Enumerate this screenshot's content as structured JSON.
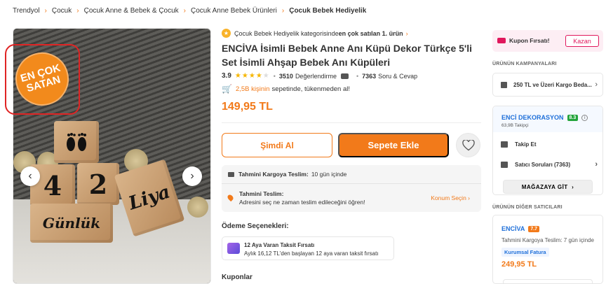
{
  "breadcrumb": [
    "Trendyol",
    "Çocuk",
    "Çocuk Anne & Bebek & Çocuk",
    "Çocuk Anne Bebek Ürünleri",
    "Çocuk Bebek Hediyelik"
  ],
  "gallery": {
    "badge_line1": "EN ÇOK",
    "badge_line2": "SATAN",
    "block_digits": [
      "4",
      "2"
    ],
    "block_text_1": "Liya",
    "block_text_2": "Günlük"
  },
  "product": {
    "bestseller_prefix": "Çocuk Bebek Hediyelik kategorisinde ",
    "bestseller_bold": "en çok satılan 1. ürün",
    "brand": "ENCİVA",
    "title": " İsimli Bebek Anne Anı Küpü Dekor Türkçe 5'li Set İsimli Ahşap Bebek Anı Küpüleri",
    "rating": "3.9",
    "rating_stars": 3.9,
    "review_count": "3510",
    "review_label": "Değerlendirme",
    "qa_count": "7363",
    "qa_label": "Soru & Cevap",
    "cart_count_text": "2,5B kişinin",
    "cart_suffix": "sepetinde, tükenmeden al!",
    "price": "149,95 TL",
    "buy_now_label": "Şimdi Al",
    "add_to_cart_label": "Sepete Ekle"
  },
  "delivery": {
    "cargo_label": "Tahmini Kargoya Teslim:",
    "cargo_value": "10 gün içinde",
    "title": "Tahmini Teslim:",
    "subtitle": "Adresini seç ne zaman teslim edileceğini öğren!",
    "location_link": "Konum Seçin"
  },
  "payment": {
    "title": "Ödeme Seçenekleri:",
    "installment_title": "12 Aya Varan Taksit Fırsatı",
    "installment_sub": "Aylık 16,12 TL'den başlayan 12 aya varan taksit fırsatı"
  },
  "coupons_title": "Kuponlar",
  "sidebar": {
    "coupon_label": "Kupon Fırsatı!",
    "coupon_button": "Kazan",
    "campaigns_title": "ÜRÜNÜN KAMPANYALARI",
    "campaign_text": "250 TL ve Üzeri Kargo Beda...",
    "seller_name": "ENCİ DEKORASYON",
    "seller_score": "8.3",
    "seller_followers": "63,9B Takipçi",
    "follow_label": "Takip Et",
    "seller_questions": "Satıcı Soruları (7363)",
    "store_button": "MAĞAZAYA GİT",
    "other_sellers_title": "ÜRÜNÜN DİĞER SATICILARI",
    "other_seller_name": "ENCİVA",
    "other_seller_score": "7.7",
    "other_delivery": "Tahmini Kargoya Teslim: 7 gün içinde",
    "other_tag": "Kurumsal Fatura",
    "other_price": "249,95 TL"
  },
  "colors": {
    "accent": "#f27a1a",
    "seller_blue": "#1e6fd9",
    "coupon_pink": "#e0185c",
    "score_green": "#23a43b"
  }
}
